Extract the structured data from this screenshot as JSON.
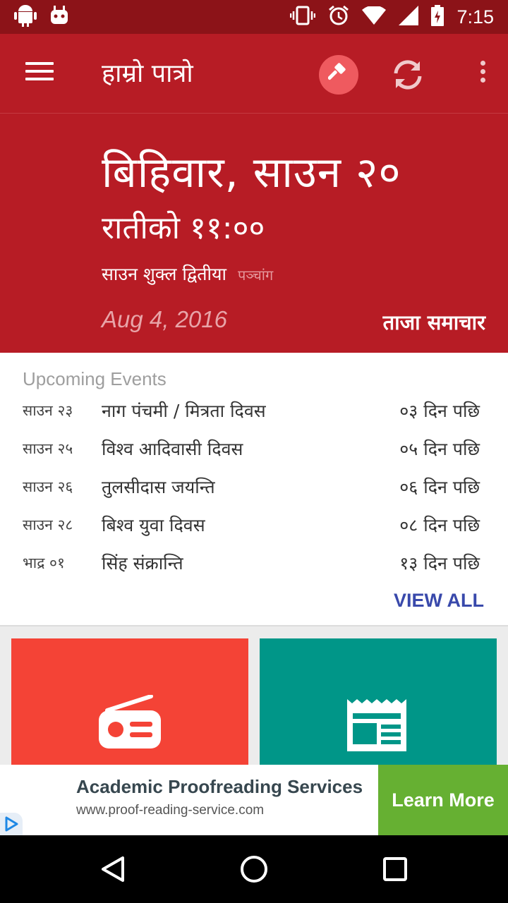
{
  "statusbar": {
    "time": "7:15",
    "icons": [
      "android-icon",
      "android-debug-icon",
      "vibrate-icon",
      "alarm-icon",
      "wifi-icon",
      "signal-icon",
      "battery-charging-icon"
    ]
  },
  "toolbar": {
    "title": "हाम्रो पात्रो",
    "icons": [
      "menu-icon",
      "hammer-icon",
      "refresh-icon",
      "overflow-icon"
    ]
  },
  "hero": {
    "day": "बिहिवार, साउन २०",
    "time": "रातीको ११:००",
    "tithi": "साउन शुक्ल द्वितीया",
    "panchang": "पञ्चांग",
    "date_en": "Aug 4, 2016",
    "news_link": "ताजा समाचार"
  },
  "events": {
    "title": "Upcoming Events",
    "items": [
      {
        "date": "साउन २३",
        "name": "नाग पंचमी / मित्रता दिवस",
        "days": "०३ दिन पछि"
      },
      {
        "date": "साउन २५",
        "name": "विश्व आदिवासी दिवस",
        "days": "०५ दिन पछि"
      },
      {
        "date": "साउन २६",
        "name": "तुलसीदास जयन्ति",
        "days": "०६ दिन पछि"
      },
      {
        "date": "साउन २८",
        "name": "बिश्व युवा दिवस",
        "days": "०८ दिन पछि"
      },
      {
        "date": "भाद्र ०१",
        "name": "सिंह संक्रान्ति",
        "days": "१३ दिन पछि"
      }
    ],
    "view_all": "VIEW ALL"
  },
  "tiles": {
    "icons": [
      "radio-icon",
      "newspaper-icon"
    ],
    "colors": {
      "radio": "#f44336",
      "news": "#009688"
    }
  },
  "ad": {
    "headline": "Academic Proofreading Services",
    "url": "www.proof-reading-service.com",
    "cta": "Learn More"
  },
  "colors": {
    "primary": "#b71c25",
    "primary_dark": "#8c1318",
    "accent": "#3949ab",
    "cta": "#66b032"
  }
}
